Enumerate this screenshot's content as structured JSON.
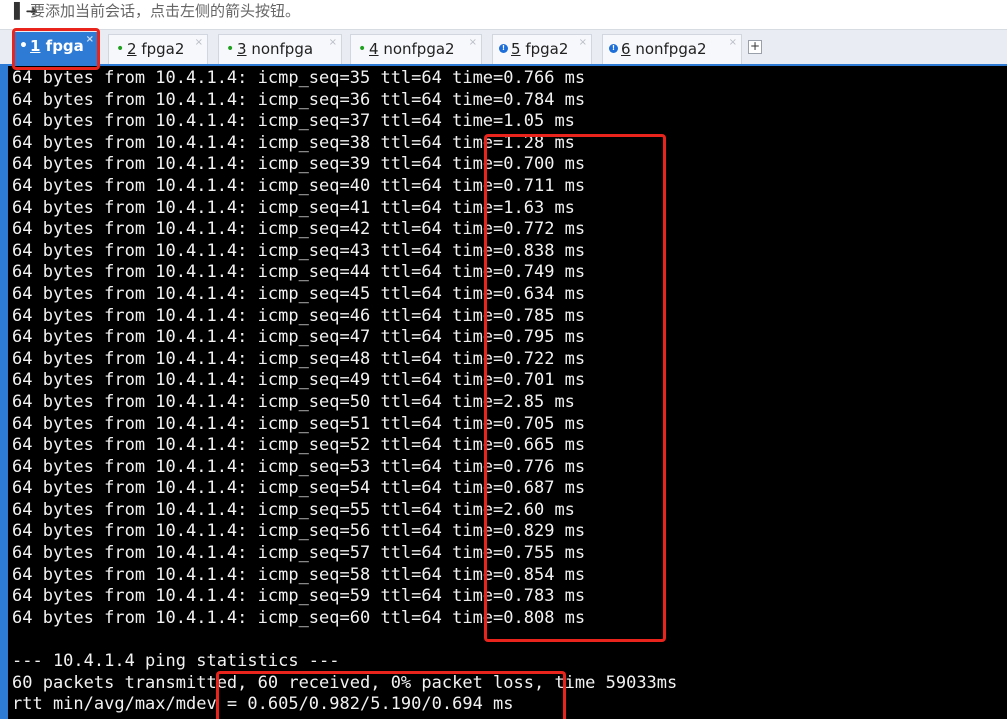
{
  "hint": {
    "arrow": "▌➜",
    "text": "要添加当前会话，点击左侧的箭头按钮。"
  },
  "tabs": [
    {
      "num": "1",
      "name": "fpga",
      "marker": "•",
      "marker_type": "bullet",
      "active": true
    },
    {
      "num": "2",
      "name": "fpga2",
      "marker": "•",
      "marker_type": "bullet",
      "active": false
    },
    {
      "num": "3",
      "name": "nonfpga",
      "marker": "•",
      "marker_type": "bullet",
      "active": false
    },
    {
      "num": "4",
      "name": "nonfpga2",
      "marker": "•",
      "marker_type": "bullet",
      "active": false
    },
    {
      "num": "5",
      "name": "fpga2",
      "marker": "!",
      "marker_type": "info",
      "active": false
    },
    {
      "num": "6",
      "name": "nonfpga2",
      "marker": "!",
      "marker_type": "info",
      "active": false
    }
  ],
  "tab_close_glyph": "×",
  "add_tab_label": "+",
  "colors": {
    "accent": "#2e7bd6",
    "bullet_green": "#20a020",
    "annotation_red": "#e8241c",
    "terminal_bg": "#000000",
    "terminal_fg": "#f2f2f2"
  },
  "terminal": {
    "lines": [
      "64 bytes from 10.4.1.4: icmp_seq=35 ttl=64 time=0.766 ms",
      "64 bytes from 10.4.1.4: icmp_seq=36 ttl=64 time=0.784 ms",
      "64 bytes from 10.4.1.4: icmp_seq=37 ttl=64 time=1.05 ms",
      "64 bytes from 10.4.1.4: icmp_seq=38 ttl=64 time=1.28 ms",
      "64 bytes from 10.4.1.4: icmp_seq=39 ttl=64 time=0.700 ms",
      "64 bytes from 10.4.1.4: icmp_seq=40 ttl=64 time=0.711 ms",
      "64 bytes from 10.4.1.4: icmp_seq=41 ttl=64 time=1.63 ms",
      "64 bytes from 10.4.1.4: icmp_seq=42 ttl=64 time=0.772 ms",
      "64 bytes from 10.4.1.4: icmp_seq=43 ttl=64 time=0.838 ms",
      "64 bytes from 10.4.1.4: icmp_seq=44 ttl=64 time=0.749 ms",
      "64 bytes from 10.4.1.4: icmp_seq=45 ttl=64 time=0.634 ms",
      "64 bytes from 10.4.1.4: icmp_seq=46 ttl=64 time=0.785 ms",
      "64 bytes from 10.4.1.4: icmp_seq=47 ttl=64 time=0.795 ms",
      "64 bytes from 10.4.1.4: icmp_seq=48 ttl=64 time=0.722 ms",
      "64 bytes from 10.4.1.4: icmp_seq=49 ttl=64 time=0.701 ms",
      "64 bytes from 10.4.1.4: icmp_seq=50 ttl=64 time=2.85 ms",
      "64 bytes from 10.4.1.4: icmp_seq=51 ttl=64 time=0.705 ms",
      "64 bytes from 10.4.1.4: icmp_seq=52 ttl=64 time=0.665 ms",
      "64 bytes from 10.4.1.4: icmp_seq=53 ttl=64 time=0.776 ms",
      "64 bytes from 10.4.1.4: icmp_seq=54 ttl=64 time=0.687 ms",
      "64 bytes from 10.4.1.4: icmp_seq=55 ttl=64 time=2.60 ms",
      "64 bytes from 10.4.1.4: icmp_seq=56 ttl=64 time=0.829 ms",
      "64 bytes from 10.4.1.4: icmp_seq=57 ttl=64 time=0.755 ms",
      "64 bytes from 10.4.1.4: icmp_seq=58 ttl=64 time=0.854 ms",
      "64 bytes from 10.4.1.4: icmp_seq=59 ttl=64 time=0.783 ms",
      "64 bytes from 10.4.1.4: icmp_seq=60 ttl=64 time=0.808 ms",
      "",
      "--- 10.4.1.4 ping statistics ---",
      "60 packets transmitted, 60 received, 0% packet loss, time 59033ms",
      "rtt min/avg/max/mdev = 0.605/0.982/5.190/0.694 ms"
    ]
  }
}
